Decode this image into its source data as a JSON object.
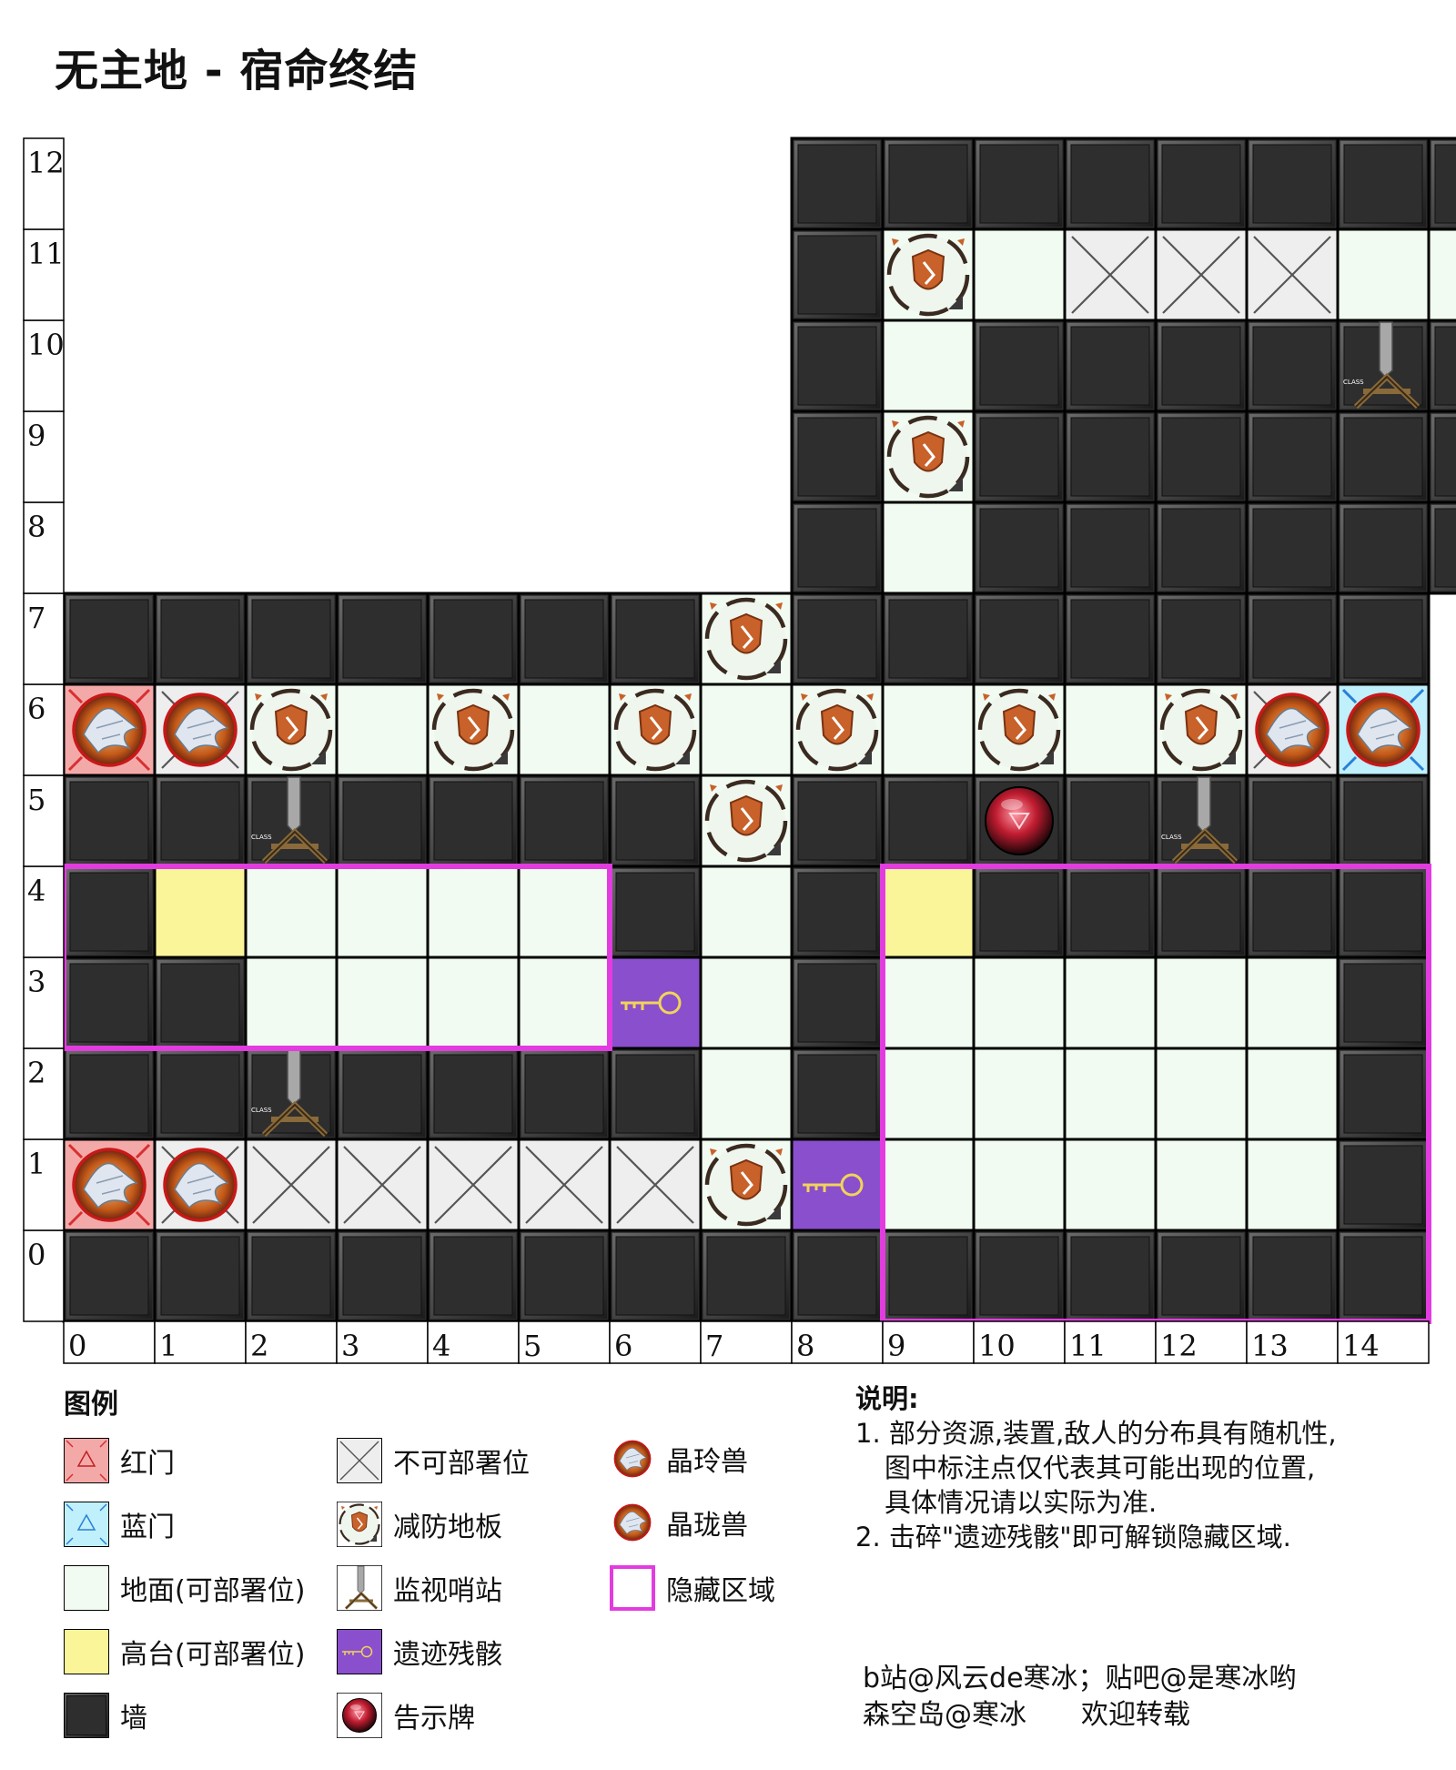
{
  "title": "无主地 - 宿命终结",
  "row_labels": [
    "0",
    "1",
    "2",
    "3",
    "4",
    "5",
    "6",
    "7",
    "8",
    "9",
    "10",
    "11",
    "12"
  ],
  "col_labels": [
    "0",
    "1",
    "2",
    "3",
    "4",
    "5",
    "6",
    "7",
    "8",
    "9",
    "10",
    "11",
    "12",
    "13",
    "14"
  ],
  "map": [
    "....... WWWWWWWWW",
    "....... WDGXXXGGGR",
    "....... WGWWWWSWW",
    "....... WDWWWWWWW",
    "....... WGWWWWWWW",
    "WWWWWWWDWWWWWWW",
    "RCDGDGDGDGDGDCB",
    "WWSWWWWDWWNWSWW",
    "WHGGGGWGWHWWWWW",
    "WWGGGGKGWGGGGGW",
    "WWSWWWWGWGGGGGW",
    "RCXXXXXDKGGGGGW",
    "WWWWWWWWWWWWWWW"
  ],
  "hidden_areas": [
    {
      "cols": [
        0,
        5
      ],
      "rows": [
        3,
        4
      ]
    },
    {
      "cols": [
        9,
        14
      ],
      "rows": [
        0,
        4
      ]
    }
  ],
  "legend": {
    "title": "图例",
    "items": [
      {
        "icon": "red-gate-icon",
        "label": "红门"
      },
      {
        "icon": "blue-gate-icon",
        "label": "蓝门"
      },
      {
        "icon": "ground-tile-icon",
        "label": "地面(可部署位)"
      },
      {
        "icon": "highground-tile-icon",
        "label": "高台(可部署位)"
      },
      {
        "icon": "wall-tile-icon",
        "label": "墙"
      },
      {
        "icon": "undeployable-tile-icon",
        "label": "不可部署位"
      },
      {
        "icon": "defense-down-floor-icon",
        "label": "减防地板"
      },
      {
        "icon": "watch-post-icon",
        "label": "监视哨站"
      },
      {
        "icon": "ruins-remains-icon",
        "label": "遗迹残骸"
      },
      {
        "icon": "notice-board-icon",
        "label": "告示牌"
      },
      {
        "icon": "crystal-beast-a-icon",
        "label": "晶玲兽"
      },
      {
        "icon": "crystal-beast-b-icon",
        "label": "晶珑兽"
      },
      {
        "icon": "hidden-area-icon",
        "label": "隐藏区域"
      }
    ]
  },
  "notes": {
    "heading": "说明:",
    "line1": "1. 部分资源,装置,敌人的分布具有随机性,",
    "line2": "图中标注点仅代表其可能出现的位置,",
    "line3": "具体情况请以实际为准.",
    "line4": "2. 击碎\"遗迹残骸\"即可解锁隐藏区域."
  },
  "credits": {
    "line1": "b站@风云de寒冰；贴吧@是寒冰哟",
    "line2": "森空岛@寒冰　　欢迎转载"
  },
  "watch_post_tag": "CLASS",
  "colors": {
    "wall": "#2e2e2e",
    "ground": "#f1fbf1",
    "highground": "#fbf59a",
    "undeployable": "#eeeeee",
    "red_gate": "#f4a9a9",
    "blue_gate": "#bff0fb",
    "ruins": "#8a4fcc",
    "hidden_border": "#e23ce0",
    "defense_down": "#c8612a"
  }
}
